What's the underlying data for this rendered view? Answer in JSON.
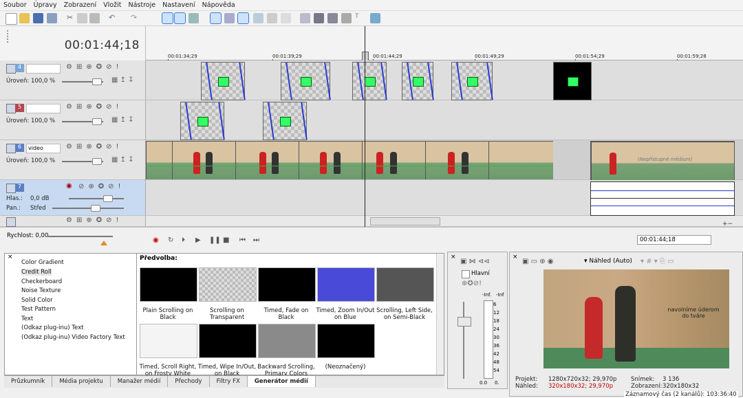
{
  "menu": [
    "Soubor",
    "Úpravy",
    "Zobrazení",
    "Vložit",
    "Nástroje",
    "Nastavení",
    "Nápověda"
  ],
  "timeline": {
    "current_time": "00:01:44;18",
    "ruler_labels": [
      "00:01:34;29",
      "00:01:39;29",
      "00:01:44;29",
      "00:01:49;29",
      "00:01:54;29",
      "00:01:59;28"
    ]
  },
  "tracks": [
    {
      "num": "4",
      "name": "",
      "level_label": "Úroveň: 100,0 %"
    },
    {
      "num": "5",
      "name": "",
      "level_label": "Úroveň: 100,0 %"
    },
    {
      "num": "6",
      "name": "video",
      "level_label": "Úroveň: 100,0 %"
    },
    {
      "num": "7",
      "volume_label": "Hlas.:",
      "volume_value": "0,0 dB",
      "pan_label": "Pan.:",
      "pan_value": "Střed"
    }
  ],
  "clip_offline_text": "(Nepřístupné médium)",
  "transport": {
    "speed_label": "Rychlost: 0,00",
    "time": "00:01:44;18"
  },
  "generator_list": [
    "Color Gradient",
    "Credit Roll",
    "Checkerboard",
    "Noise Texture",
    "Solid Color",
    "Test Pattern",
    "Text",
    "(Odkaz plug-inu) Text",
    "(Odkaz plug-inu) Video Factory Text"
  ],
  "presets_title": "Předvolba:",
  "presets": [
    "Plain Scrolling on Black",
    "Scrolling on Transparent",
    "Timed, Fade on Black",
    "Timed, Zoom In/Out on Blue",
    "Scrolling, Left Side, on Semi-Black",
    "Timed, Scroll Right, on Frosty White",
    "Timed, Wipe In/Out, on Black",
    "Backward Scrolling, Primary Colors",
    "(Neoznačený)"
  ],
  "tabs": [
    "Průzkumník",
    "Média projektu",
    "Manažer médií",
    "Přechody",
    "Filtry FX",
    "Generátor médií"
  ],
  "mixer": {
    "label": "Hlavní",
    "meter_top": [
      "-Inf.",
      "-Inf"
    ],
    "scale": [
      "6",
      "12",
      "18",
      "24",
      "30",
      "36",
      "42",
      "48",
      "54"
    ],
    "bottom": [
      "0.0",
      "0."
    ]
  },
  "preview": {
    "mode_label": "Náhled (Auto)",
    "overlay_text": "navolníme úderom do tváre",
    "project_label": "Projekt:",
    "project_value": "1280x720x32; 29,970p",
    "preview_label": "Náhled:",
    "preview_value": "320x180x32; 29,970p",
    "frame_label": "Snímek:",
    "frame_value": "3 136",
    "display_label": "Zobrazení:",
    "display_value": "320x180x32",
    "record_label": "Záznamový čas (2 kanálů): 103:36:40"
  },
  "colors": {
    "track4": "#7aa6d6",
    "track5": "#b0474f",
    "track6": "#5a7fc4",
    "track7": "#5a7fc4",
    "accent": "#3a7bd5",
    "record": "#c00000"
  }
}
